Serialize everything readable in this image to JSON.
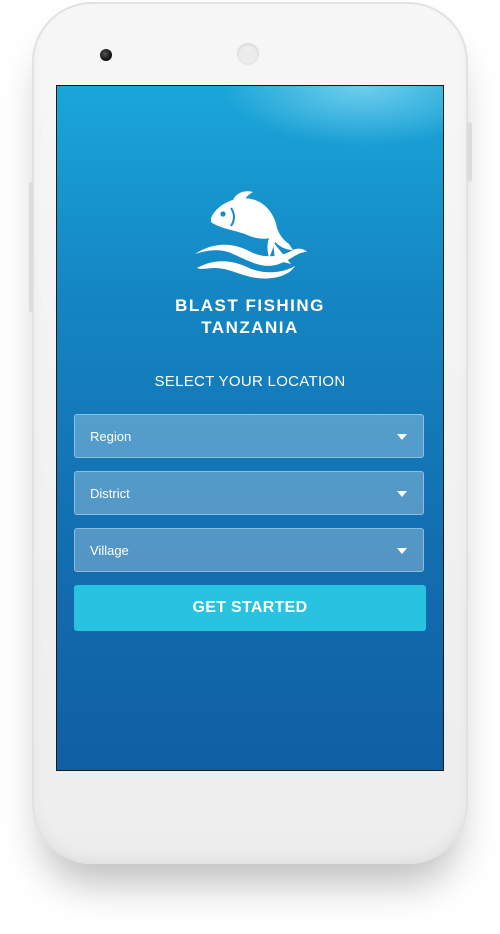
{
  "app": {
    "brand_line1": "BLAST FISHING",
    "brand_line2": "TANZANIA",
    "logo_icon": "fish-wave-icon"
  },
  "location": {
    "title": "SELECT YOUR LOCATION",
    "fields": [
      {
        "label": "Region",
        "icon": "chevron-down-icon"
      },
      {
        "label": "District",
        "icon": "chevron-down-icon"
      },
      {
        "label": "Village",
        "icon": "chevron-down-icon"
      }
    ],
    "submit_label": "GET STARTED"
  },
  "colors": {
    "screen_top": "#1aa6d9",
    "screen_bottom": "#0f5fa3",
    "button": "#27c3e0",
    "text": "#ffffff"
  }
}
